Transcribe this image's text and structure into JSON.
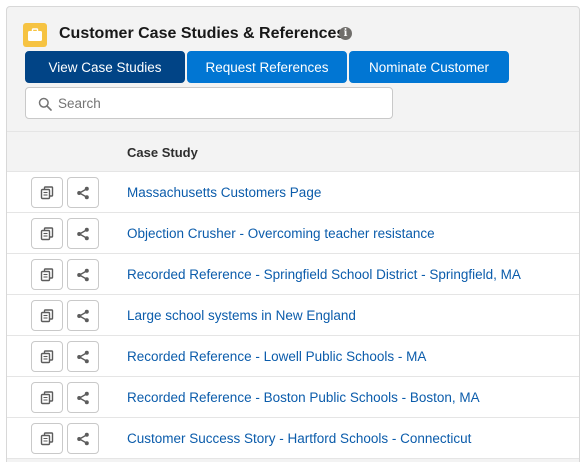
{
  "header": {
    "title": "Customer Case Studies & References",
    "app_icon": "briefcase-icon",
    "info_icon": "info-icon",
    "accent_color": "#f6c342"
  },
  "buttons": {
    "view_case_studies": "View Case Studies",
    "request_references": "Request References",
    "nominate_customer": "Nominate Customer",
    "active": "view_case_studies",
    "brand_color": "#0176d3",
    "active_color": "#014486"
  },
  "search": {
    "placeholder": "Search",
    "value": ""
  },
  "table": {
    "column_header": "Case Study",
    "row_icons": [
      "copy-icon",
      "share-icon"
    ],
    "rows": [
      "Massachusetts Customers Page",
      "Objection Crusher - Overcoming teacher resistance",
      "Recorded Reference - Springfield School District - Springfield, MA",
      "Large school systems in New England",
      "Recorded Reference - Lowell Public Schools - MA",
      "Recorded Reference - Boston Public Schools - Boston, MA",
      "Customer Success Story - Hartford Schools - Connecticut"
    ]
  }
}
